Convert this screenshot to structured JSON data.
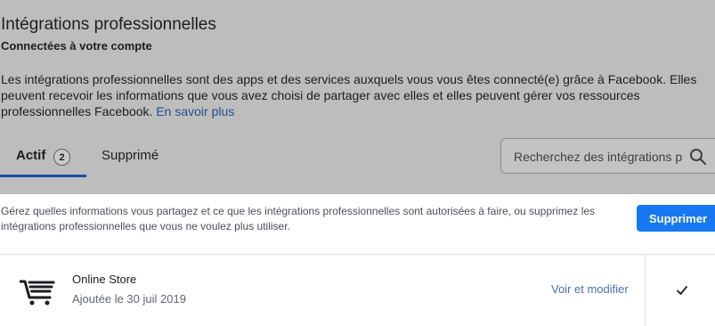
{
  "header": {
    "title": "Intégrations professionnelles",
    "subtitle": "Connectées à votre compte",
    "description": "Les intégrations professionnelles sont des apps et des services auxquels vous vous êtes connecté(e) grâce à Facebook. Elles peuvent recevoir les informations que vous avez choisi de partager avec elles et elles peuvent gérer vos ressources professionnelles Facebook.",
    "learn_more": "En savoir plus"
  },
  "tabs": {
    "active_label": "Actif",
    "active_count": "2",
    "deleted_label": "Supprimé"
  },
  "search": {
    "placeholder": "Recherchez des intégrations p",
    "icon": "search-icon"
  },
  "manage": {
    "text": "Gérez quelles informations vous partagez et ce que les intégrations professionnelles sont autorisées à faire, ou supprimez les intégrations professionnelles que vous ne voulez plus utiliser.",
    "remove_label": "Supprimer"
  },
  "integrations": [
    {
      "name": "Online Store",
      "added": "Ajoutée le 30 juil 2019",
      "edit_label": "Voir et modifier",
      "icon": "shopping-cart-icon",
      "selected": true
    }
  ],
  "colors": {
    "header_bg": "#bdbdbd",
    "accent": "#1877f2",
    "tab_underline": "#1a4fa3",
    "link": "#4a6fb5"
  }
}
